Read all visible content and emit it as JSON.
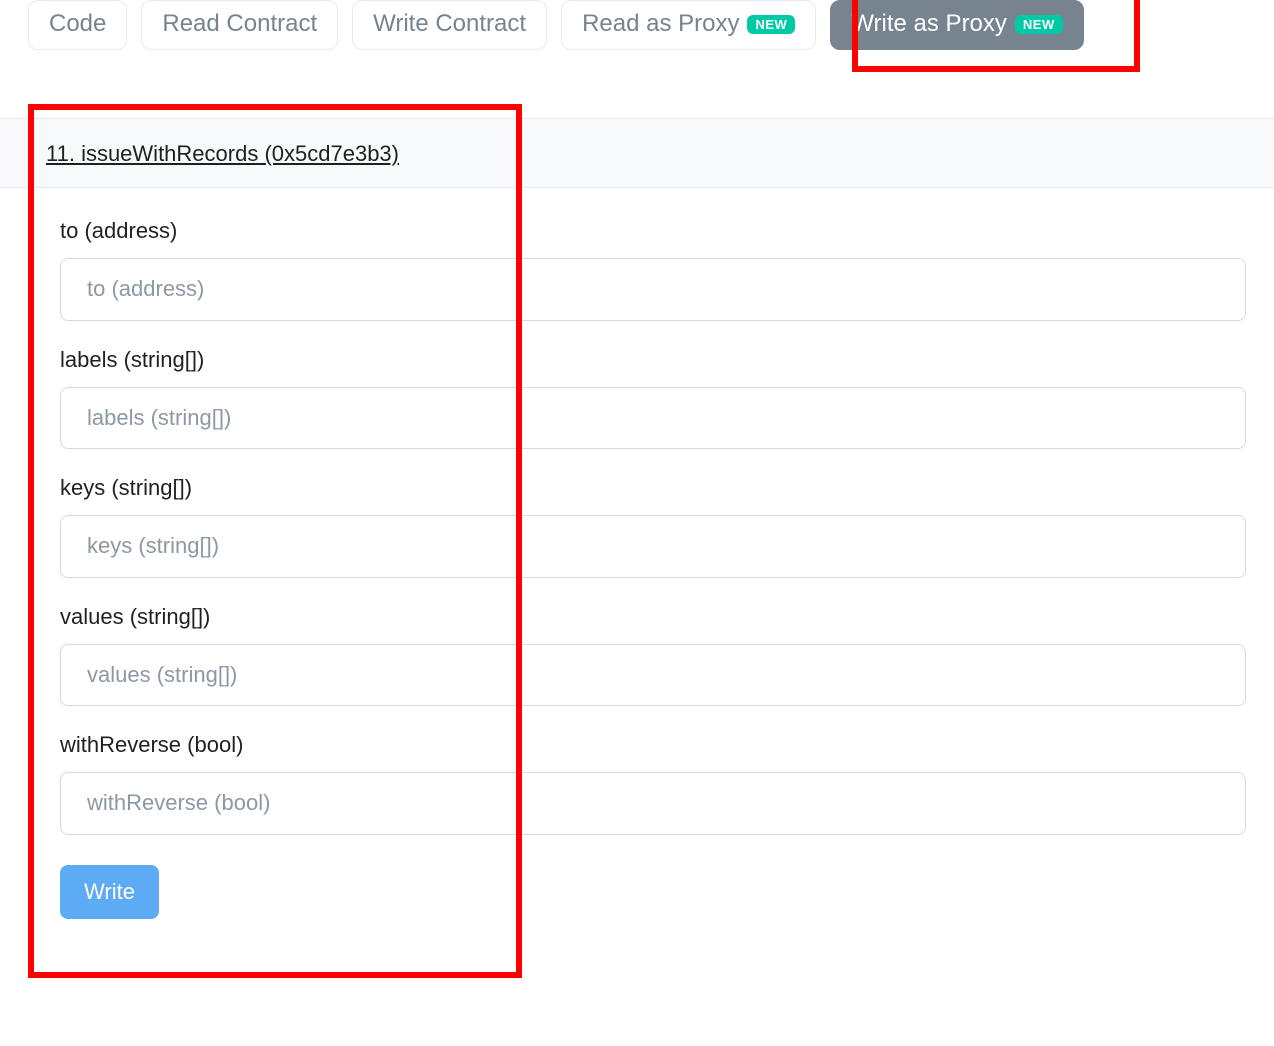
{
  "colors": {
    "accent_green": "#00c9a7",
    "accent_blue": "#5daaf5",
    "tab_active_bg": "#77838f",
    "highlight_red": "#ff0000"
  },
  "tabs": [
    {
      "label": "Code",
      "badge": null,
      "active": false
    },
    {
      "label": "Read Contract",
      "badge": null,
      "active": false
    },
    {
      "label": "Write Contract",
      "badge": null,
      "active": false
    },
    {
      "label": "Read as Proxy",
      "badge": "NEW",
      "active": false
    },
    {
      "label": "Write as Proxy",
      "badge": "NEW",
      "active": true
    }
  ],
  "function": {
    "header": "11. issueWithRecords (0x5cd7e3b3)",
    "fields": [
      {
        "label": "to (address)",
        "placeholder": "to (address)"
      },
      {
        "label": "labels (string[])",
        "placeholder": "labels (string[])"
      },
      {
        "label": "keys (string[])",
        "placeholder": "keys (string[])"
      },
      {
        "label": "values (string[])",
        "placeholder": "values (string[])"
      },
      {
        "label": "withReverse (bool)",
        "placeholder": "withReverse (bool)"
      }
    ],
    "submit_label": "Write"
  }
}
